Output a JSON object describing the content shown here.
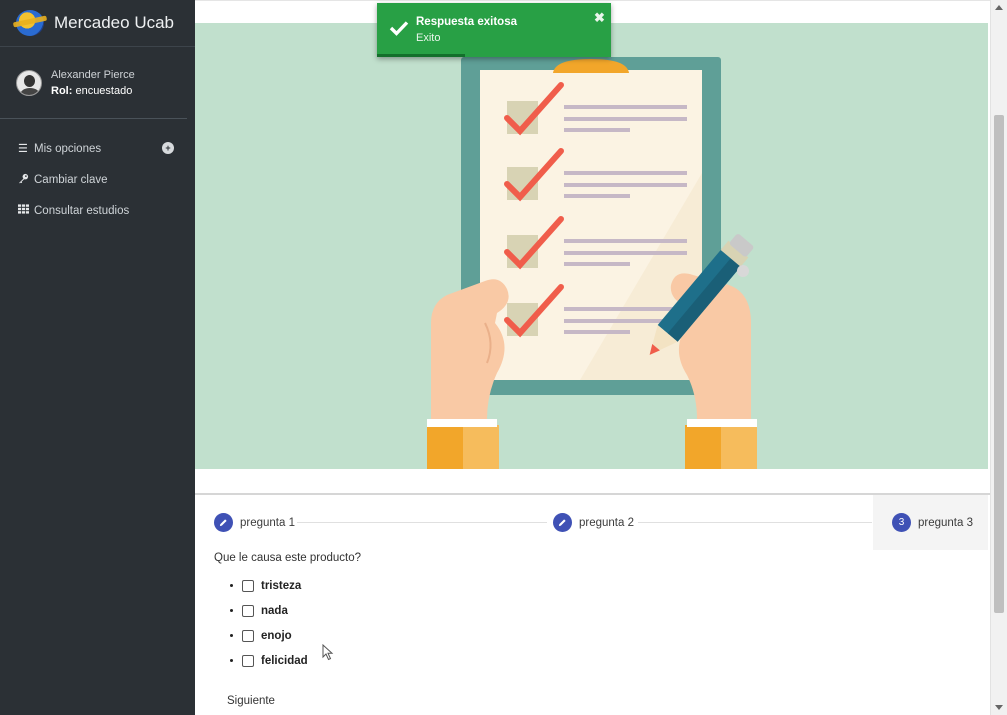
{
  "brand": {
    "title": "Mercadeo Ucab"
  },
  "user": {
    "name": "Alexander Pierce",
    "role_label": "Rol:",
    "role_value": "encuestado"
  },
  "menu": {
    "items": [
      {
        "label": "Mis opciones",
        "icon": "bars-icon"
      },
      {
        "label": "Cambiar clave",
        "icon": "key-icon"
      },
      {
        "label": "Consultar estudios",
        "icon": "grid-icon"
      }
    ]
  },
  "toast": {
    "title": "Respuesta exitosa",
    "message": "Exito"
  },
  "stepper": {
    "steps": [
      {
        "label": "pregunta 1",
        "state": "completed",
        "icon": "pencil-icon"
      },
      {
        "label": "pregunta 2",
        "state": "completed",
        "icon": "pencil-icon"
      },
      {
        "label": "pregunta 3",
        "state": "active",
        "number": "3"
      }
    ]
  },
  "question": {
    "text": "Que le causa este producto?",
    "options": [
      "tristeza",
      "nada",
      "enojo",
      "felicidad"
    ]
  },
  "actions": {
    "next_label": "Siguiente"
  },
  "colors": {
    "sidebar": "#2b3035",
    "hero": "#c1e0cd",
    "toast": "#28a045",
    "step": "#3f51b5"
  }
}
